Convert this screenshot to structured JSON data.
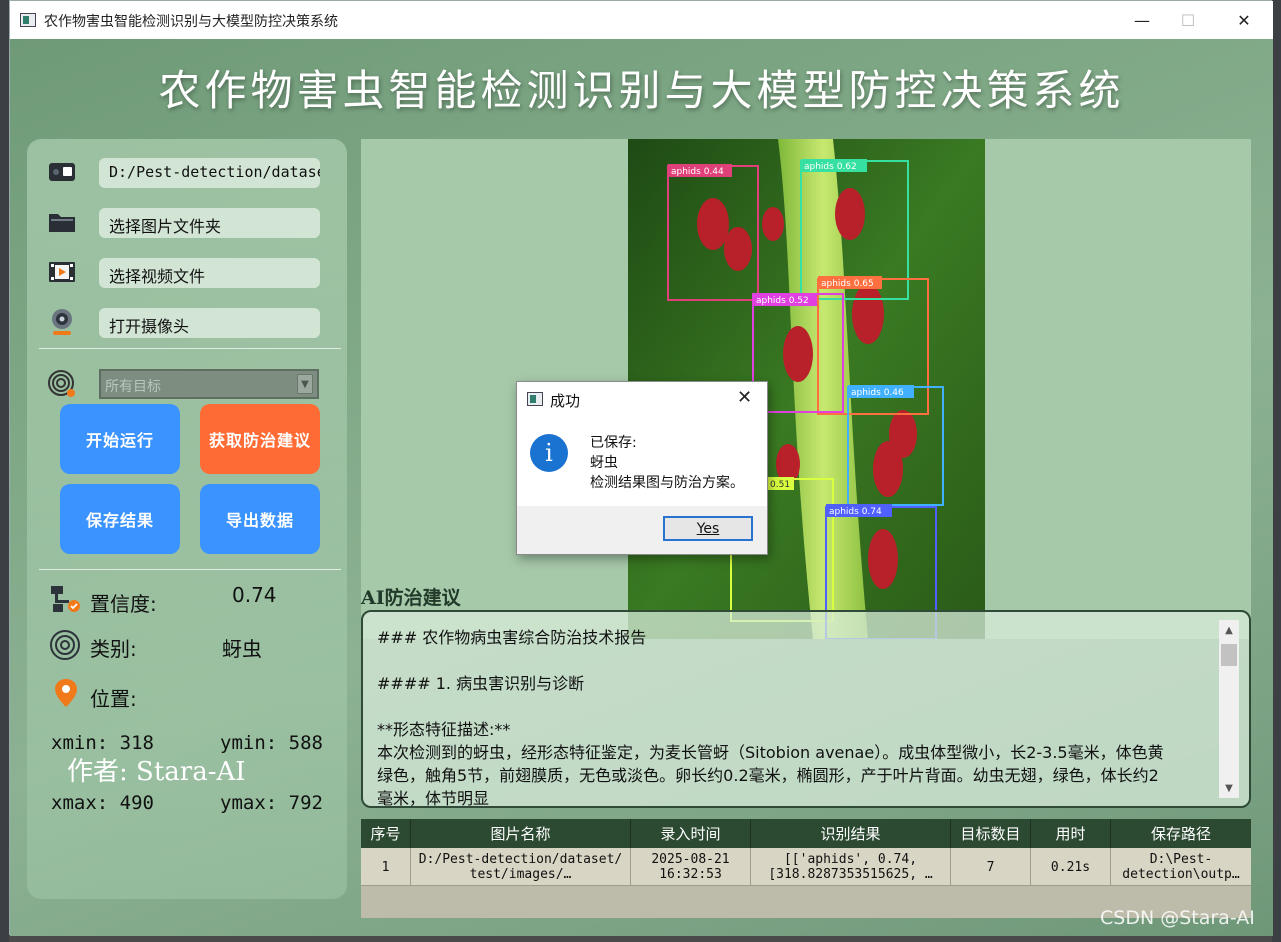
{
  "window": {
    "title": "农作物害虫智能检测识别与大模型防控决策系统",
    "minimize": "—",
    "maximize": "☐",
    "close": "✕"
  },
  "header": {
    "title": "农作物害虫智能检测识别与大模型防控决策系统"
  },
  "sidebar": {
    "image_path": "D:/Pest-detection/dataset/test/images/",
    "select_folder": "选择图片文件夹",
    "select_video": "选择视频文件",
    "open_camera": "打开摄像头",
    "target_select": "所有目标",
    "btn_start": "开始运行",
    "btn_advice": "获取防治建议",
    "btn_save": "保存结果",
    "btn_export": "导出数据",
    "confidence_label": "置信度:",
    "confidence_value": "0.74",
    "class_label": "类别:",
    "class_value": "蚜虫",
    "position_label": "位置:",
    "xmin": "xmin:  318",
    "ymin": "ymin:  588",
    "xmax": "xmax:  490",
    "ymax": "ymax:  792",
    "author": "作者: Stara-AI"
  },
  "detections": [
    {
      "label": "aphids 0.44",
      "color": "#e0407a"
    },
    {
      "label": "aphids 0.62",
      "color": "#36e0a0"
    },
    {
      "label": "aphids 0.65",
      "color": "#ff7040"
    },
    {
      "label": "aphids 0.52",
      "color": "#e040e0"
    },
    {
      "label": "aphids 0.46",
      "color": "#40b0ff"
    },
    {
      "label": "0.51",
      "color": "#d8ff40"
    },
    {
      "label": "aphids 0.74",
      "color": "#5060ff"
    }
  ],
  "ai": {
    "title": "AI防治建议",
    "lines": [
      "### 农作物病虫害综合防治技术报告",
      "",
      "#### 1. 病虫害识别与诊断",
      "",
      "**形态特征描述:**",
      "本次检测到的蚜虫，经形态特征鉴定，为麦长管蚜（Sitobion avenae）。成虫体型微小，长2-3.5毫米，体色黄",
      "绿色，触角5节，前翅膜质，无色或淡色。卵长约0.2毫米，椭圆形，产于叶片背面。幼虫无翅，绿色，体长约2",
      "毫米，体节明显"
    ]
  },
  "table": {
    "headers": [
      "序号",
      "图片名称",
      "录入时间",
      "识别结果",
      "目标数目",
      "用时",
      "保存路径"
    ],
    "row": {
      "index": "1",
      "name": "D:/Pest-detection/dataset/\ntest/images/…",
      "time": "2025-08-21\n16:32:53",
      "result": "[['aphids', 0.74,\n[318.8287353515625, …",
      "count": "7",
      "duration": "0.21s",
      "path": "D:\\Pest-\ndetection\\outp…"
    }
  },
  "dialog": {
    "title": "成功",
    "icon": "i",
    "line1": "已保存:",
    "line2": "蚜虫",
    "line3": "检测结果图与防治方案。",
    "yes": "Yes"
  },
  "watermark": "CSDN @Stara-AI"
}
